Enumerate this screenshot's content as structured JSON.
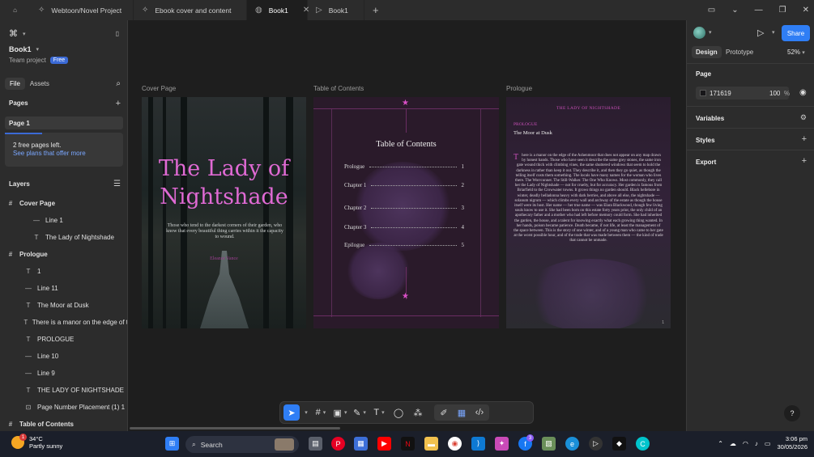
{
  "tabs": [
    {
      "label": "Webtoon/Novel Project",
      "active": false
    },
    {
      "label": "Ebook cover and content",
      "active": false
    },
    {
      "label": "Book1",
      "active": true
    },
    {
      "label": "Book1",
      "active": false
    }
  ],
  "left_panel": {
    "file_name": "Book1",
    "team": "Team project",
    "plan_badge": "Free",
    "tab_file": "File",
    "tab_assets": "Assets",
    "pages_heading": "Pages",
    "current_page": "Page 1",
    "notice_line1": "2 free pages left.",
    "notice_link": "See plans that offer more",
    "notice_progress": 0.33,
    "layers_heading": "Layers",
    "layers": [
      {
        "label": "Cover Page",
        "type": "frame"
      },
      {
        "label": "Line 1",
        "type": "line"
      },
      {
        "label": "The Lady of Nightshade",
        "type": "text"
      },
      {
        "label": "Prologue",
        "type": "frame"
      },
      {
        "label": "1",
        "type": "text"
      },
      {
        "label": "Line 11",
        "type": "line"
      },
      {
        "label": "The Moor at Dusk",
        "type": "text"
      },
      {
        "label": "There is a manor on the edge of t",
        "type": "text"
      },
      {
        "label": "PROLOGUE",
        "type": "text"
      },
      {
        "label": "Line 10",
        "type": "line"
      },
      {
        "label": "Line 9",
        "type": "line"
      },
      {
        "label": "THE LADY OF NIGHTSHADE",
        "type": "text"
      },
      {
        "label": "Page Number Placement (1) 1",
        "type": "component"
      },
      {
        "label": "Table of Contents",
        "type": "frame"
      }
    ]
  },
  "canvas": {
    "labels": {
      "cover": "Cover Page",
      "toc": "Table of Contents",
      "prologue": "Prologue"
    },
    "cover": {
      "title_line1": "The Lady of",
      "title_line2": "Nightshade",
      "tagline": "Those who tend to the darkest corners of their garden, who know that every beautiful thing carries within it the capacity to wound.",
      "author": "Eleanor Vance"
    },
    "toc": {
      "title": "Table of Contents",
      "entries": [
        {
          "label": "Prologue",
          "page": "1"
        },
        {
          "label": "Chapter 1",
          "page": "2"
        },
        {
          "label": "Chapter 2",
          "page": "3"
        },
        {
          "label": "Chapter 3",
          "page": "4"
        },
        {
          "label": "Epilogue",
          "page": "5"
        }
      ]
    },
    "prologue": {
      "running_head": "THE LADY OF NIGHTSHADE",
      "label": "PROLOGUE",
      "subtitle": "The Moor at Dusk",
      "drop_cap": "T",
      "body": "here is a manor on the edge of the Ashenmoor that does not appear on any map drawn by honest hands. Those who have seen it describe the same grey stones, the same iron gate wound thick with climbing vines, the same shuttered windows that seem to hold the darkness in rather than keep it out. They describe it, and then they go quiet, as though the telling itself costs them something. The locals have many names for the woman who lives there. The Worrcunner. The Still-Walker. The One Who Knows. Most commonly, they call her the Lady of Nightshade — not for cruelty, but for accuracy. Her garden is famous from Briarfield to the Crowwater towns. It grows things no garden should. Black hellebore in winter, deadly belladonna heavy with dark berries, and above all else, the nightshade — solanum nigrum — which climbs every wall and archway of the estate as though the house itself were its host. Her name — her true name — was Elara Blackwood, though few living souls know to use it. She had been born on this estate forty years prior, the only child of an apothecary father and a mother who had left before memory could form. She had inherited the garden, the house, and a talent for knowing exactly what each growing thing wanted. In her hands, poison became patience. Death became, if not life, at least the management of the space between. This is the story of one winter, and of a young man who came to her gate at the worst possible hour, and of the trade that was made between them — the kind of trade that cannot be unmade.",
      "page_number": "1"
    }
  },
  "right_panel": {
    "share_label": "Share",
    "tab_design": "Design",
    "tab_prototype": "Prototype",
    "zoom": "52%",
    "page_heading": "Page",
    "page_color_hex": "171619",
    "page_opacity": "100",
    "percent": "%",
    "variables": "Variables",
    "styles": "Styles",
    "export": "Export",
    "help": "?"
  },
  "taskbar": {
    "temperature": "34°C",
    "condition": "Partly sunny",
    "weather_badge": "1",
    "search_label": "Search",
    "time": "3:06 pm",
    "date": "30/05/2026",
    "facebook_badge": "3"
  },
  "colors": {
    "accent": "#2f7ef5",
    "title_pink": "#e06ad4",
    "page_bg": "#171619"
  }
}
